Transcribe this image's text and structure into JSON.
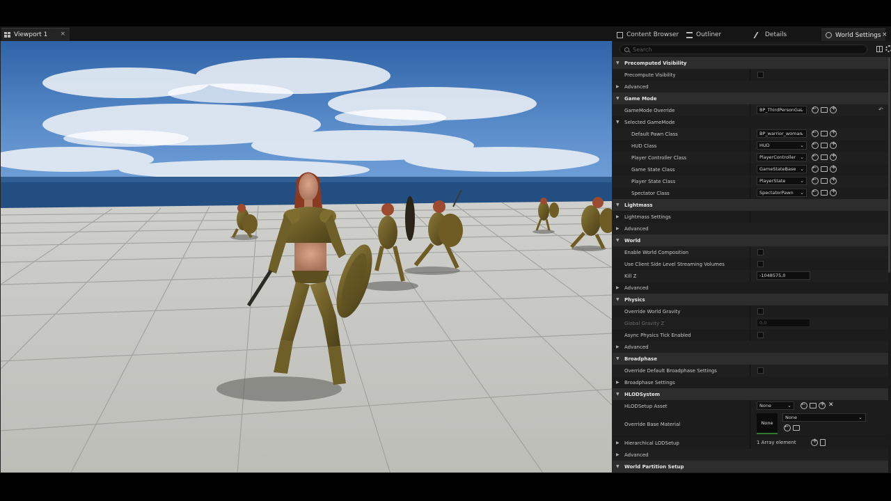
{
  "viewport_tab": {
    "label": "Viewport 1",
    "close": "×"
  },
  "panel_tabs": [
    {
      "label": "Content Browser",
      "icon": "content-browser-icon"
    },
    {
      "label": "Outliner",
      "icon": "outliner-icon"
    },
    {
      "label": "Details",
      "icon": "details-icon"
    },
    {
      "label": "World Settings",
      "icon": "world-settings-icon",
      "active": true
    }
  ],
  "panel_close": "×",
  "search": {
    "placeholder": "Search"
  },
  "rows": {
    "precomputed_visibility": "Precomputed Visibility",
    "precompute_visibility": "Precompute Visibility",
    "advanced": "Advanced",
    "game_mode": "Game Mode",
    "gamemode_override": "GameMode Override",
    "gamemode_override_value": "BP_ThirdPersonGai",
    "selected_gamemode": "Selected GameMode",
    "default_pawn_class": "Default Pawn Class",
    "default_pawn_value": "BP_warrior_woman",
    "hud_class": "HUD Class",
    "hud_value": "HUD",
    "player_controller_class": "Player Controller Class",
    "player_controller_value": "PlayerController",
    "game_state_class": "Game State Class",
    "game_state_value": "GameStateBase",
    "player_state_class": "Player State Class",
    "player_state_value": "PlayerState",
    "spectator_class": "Spectator Class",
    "spectator_value": "SpectatorPawn",
    "lightmass": "Lightmass",
    "lightmass_settings": "Lightmass Settings",
    "world": "World",
    "enable_world_composition": "Enable World Composition",
    "use_client_side_level_streaming": "Use Client Side Level Streaming Volumes",
    "kill_z": "Kill Z",
    "kill_z_value": "-1048575,0",
    "physics": "Physics",
    "override_world_gravity": "Override World Gravity",
    "global_gravity_z": "Global Gravity Z",
    "global_gravity_value": "0,0",
    "async_physics_tick": "Async Physics Tick Enabled",
    "broadphase": "Broadphase",
    "override_default_broadphase": "Override Default Broadphase Settings",
    "broadphase_settings": "Broadphase Settings",
    "hlod_system": "HLODSystem",
    "hlod_setup_asset": "HLODSetup Asset",
    "hlod_setup_value": "None",
    "override_base_material": "Override Base Material",
    "material_thumb": "None",
    "material_value": "None",
    "hierarchical_lod_setup": "Hierarchical LODSetup",
    "array_elements": "1 Array element",
    "world_partition_setup": "World Partition Setup"
  }
}
